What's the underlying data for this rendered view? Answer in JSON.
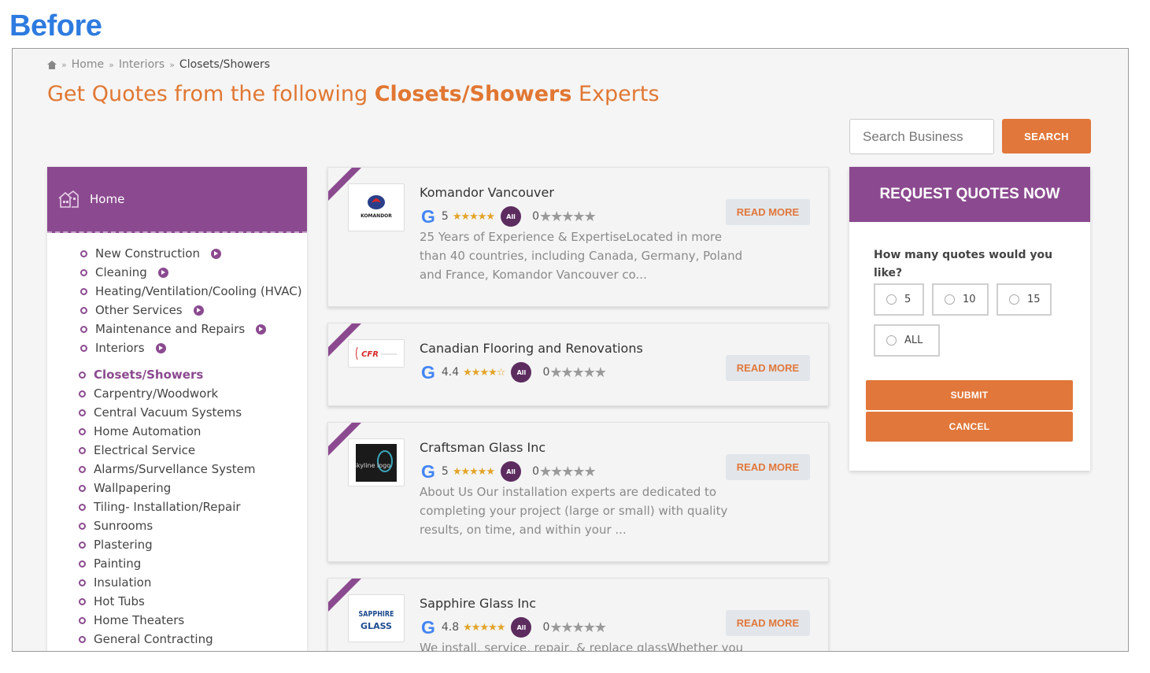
{
  "header_label": "Before",
  "breadcrumb": {
    "items": [
      "Home",
      "Interiors"
    ],
    "current": "Closets/Showers",
    "separator": "»"
  },
  "title": {
    "prefix": "Get Quotes from the following ",
    "highlight": "Closets/Showers",
    "suffix": " Experts"
  },
  "search": {
    "placeholder": "Search Business",
    "button_label": "SEARCH"
  },
  "sidebar": {
    "header_label": "Home",
    "categories": [
      {
        "label": "New Construction",
        "has_arrow": true
      },
      {
        "label": "Cleaning",
        "has_arrow": true
      },
      {
        "label": "Heating/Ventilation/Cooling (HVAC)",
        "has_arrow": false
      },
      {
        "label": "Other Services",
        "has_arrow": true
      },
      {
        "label": "Maintenance and Repairs",
        "has_arrow": true
      },
      {
        "label": "Interiors",
        "has_arrow": true
      }
    ],
    "subcategories": [
      "Closets/Showers",
      "Carpentry/Woodwork",
      "Central Vacuum Systems",
      "Home Automation",
      "Electrical Service",
      "Alarms/Survellance System",
      "Wallpapering",
      "Tiling- Installation/Repair",
      "Sunrooms",
      "Plastering",
      "Painting",
      "Insulation",
      "Hot Tubs",
      "Home Theaters",
      "General Contracting"
    ],
    "active_subcategory": "Closets/Showers"
  },
  "listings": [
    {
      "name": "Komandor Vancouver",
      "google_rating": "5",
      "stars": "★★★★★",
      "all_rating": "0",
      "description": "25 Years of Experience & ExpertiseLocated in more than 40 countries, including Canada, Germany, Poland and France, Komandor Vancouver co...",
      "read_more": "READ MORE",
      "logo_text": "KOMANDOR"
    },
    {
      "name": "Canadian Flooring and Renovations",
      "google_rating": "4.4",
      "stars": "★★★★☆",
      "all_rating": "0",
      "description": "",
      "read_more": "READ MORE",
      "logo_text": "CFR"
    },
    {
      "name": "Craftsman Glass Inc",
      "google_rating": "5",
      "stars": "★★★★★",
      "all_rating": "0",
      "description": "About Us Our installation experts are dedicated to completing your project (large or small) with quality results, on time, and within your ...",
      "read_more": "READ MORE",
      "logo_text": "Skyline logo"
    },
    {
      "name": "Sapphire Glass Inc",
      "google_rating": "4.8",
      "stars": "★★★★★",
      "all_rating": "0",
      "description": "We install, service, repair, & replace glassWhether you",
      "read_more": "READ MORE",
      "logo_text": "SAPPHIRE GLASS"
    }
  ],
  "google_letter": "G",
  "all_badge_text": "All",
  "grey_stars": "★★★★★",
  "quote_panel": {
    "title": "REQUEST QUOTES NOW",
    "question": "How many quotes would you like?",
    "options": [
      "5",
      "10",
      "15",
      "ALL"
    ],
    "submit_label": "SUBMIT",
    "cancel_label": "CANCEL"
  },
  "colors": {
    "brand_purple": "#8b4a8f",
    "accent_orange": "#e1773a",
    "label_blue": "#2e7be0"
  }
}
